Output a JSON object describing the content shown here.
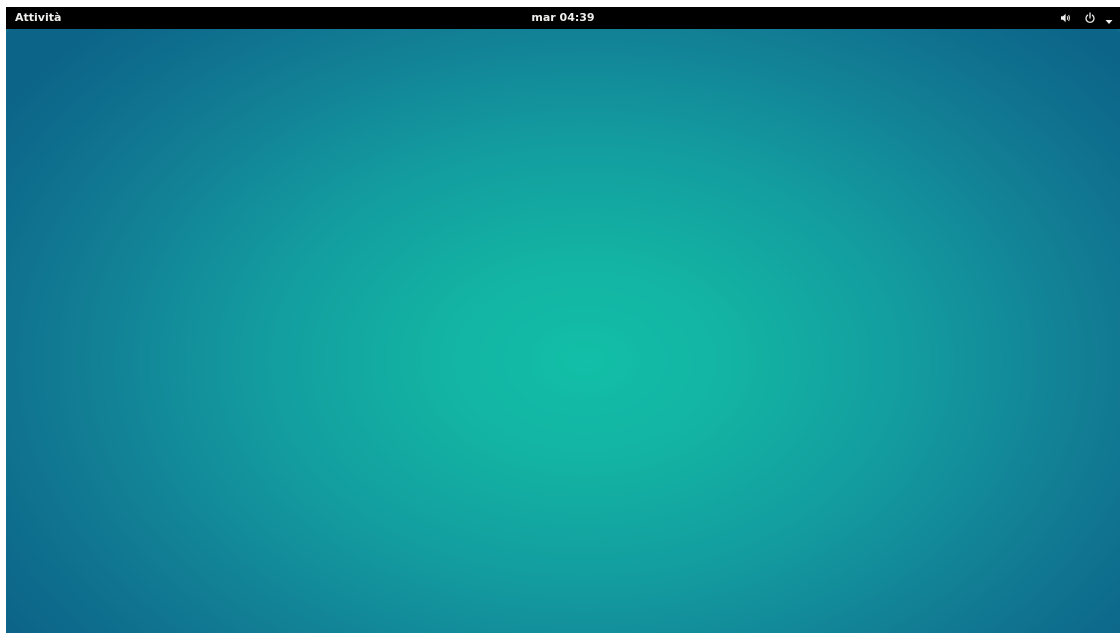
{
  "topbar": {
    "activities_label": "Attività",
    "clock_text": "mar 04:39",
    "status_icons": [
      "volume-icon",
      "power-icon",
      "dropdown-arrow-icon"
    ]
  },
  "desktop": {
    "wallpaper_center_color": "#12bfa7",
    "wallpaper_edge_color": "#0c6588",
    "panel_color": "#000000",
    "panel_text_color": "#eeeeec"
  }
}
